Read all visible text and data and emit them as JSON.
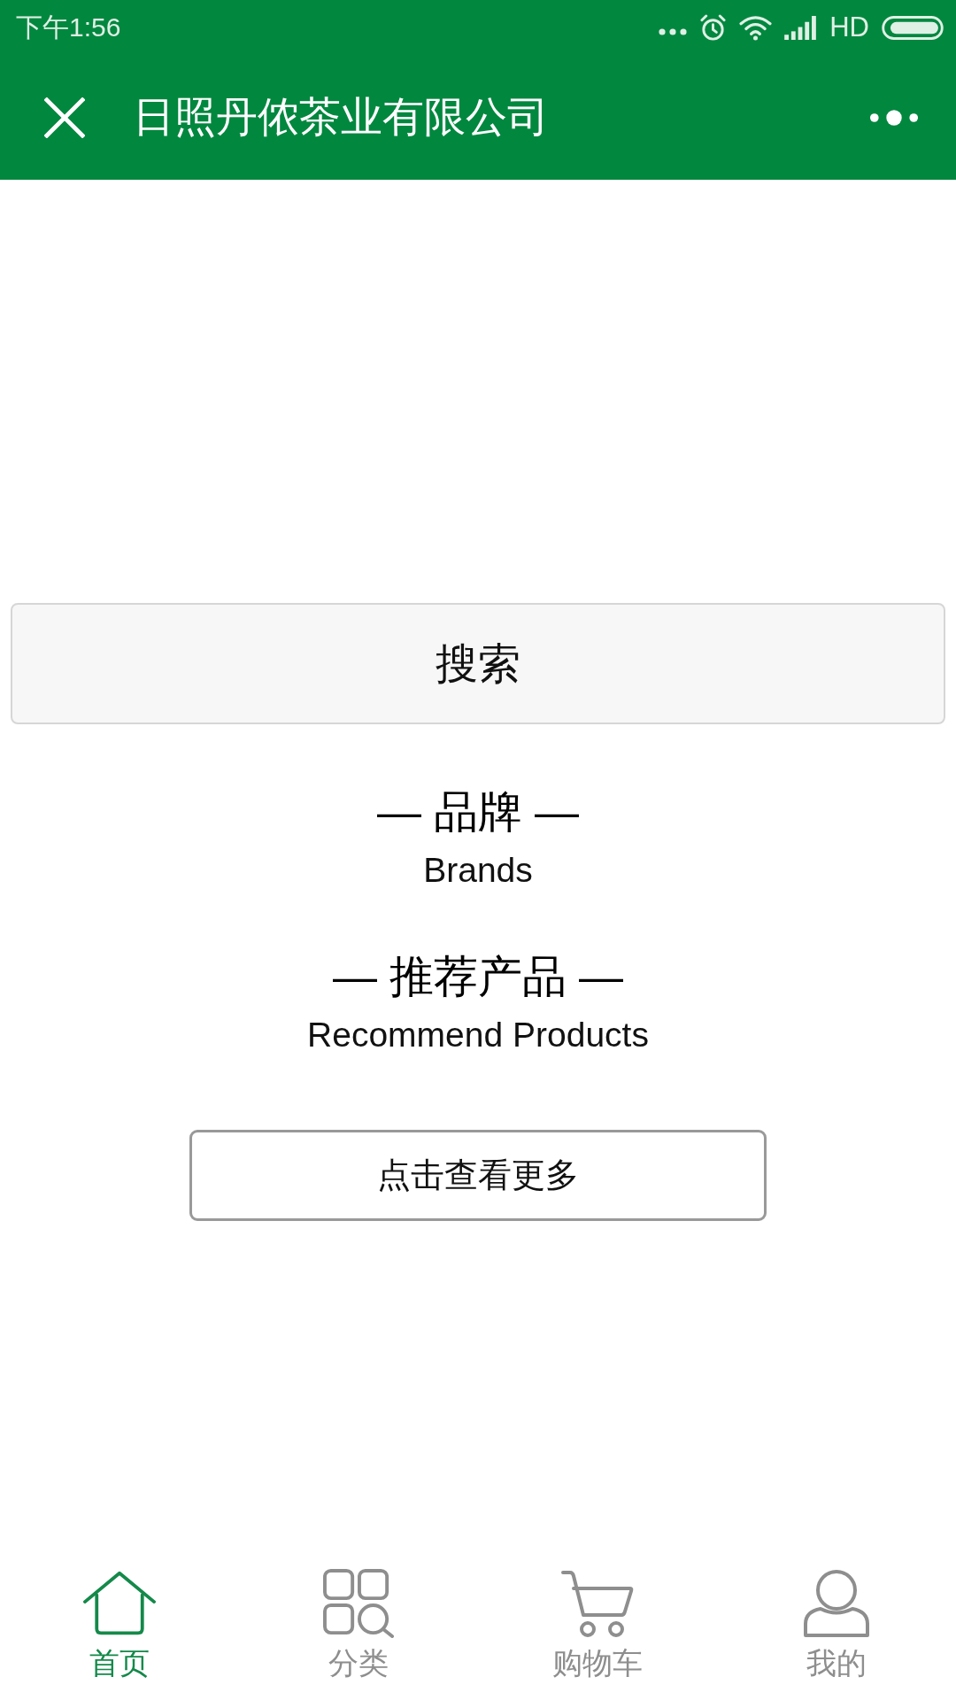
{
  "status_bar": {
    "time": "下午1:56",
    "network": "HD"
  },
  "header": {
    "title": "日照丹侬茶业有限公司"
  },
  "search": {
    "label": "搜索"
  },
  "sections": [
    {
      "title": "— 品牌 —",
      "subtitle": "Brands"
    },
    {
      "title": "— 推荐产品 —",
      "subtitle": "Recommend Products"
    }
  ],
  "more_button": {
    "label": "点击查看更多"
  },
  "tab_bar": [
    {
      "label": "首页",
      "kind": "home",
      "selected": true
    },
    {
      "label": "分类",
      "kind": "category",
      "selected": false
    },
    {
      "label": "购物车",
      "kind": "cart",
      "selected": false
    },
    {
      "label": "我的",
      "kind": "profile",
      "selected": false
    }
  ]
}
